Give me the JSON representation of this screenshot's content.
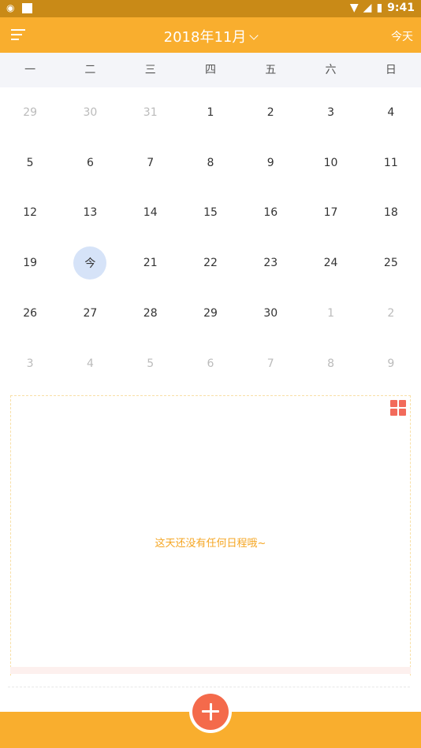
{
  "status": {
    "time": "9:41"
  },
  "header": {
    "title": "2018年11月",
    "today_label": "今天"
  },
  "weekdays": [
    "一",
    "二",
    "三",
    "四",
    "五",
    "六",
    "日"
  ],
  "calendar": {
    "rows": [
      [
        "29",
        "30",
        "31",
        "1",
        "2",
        "3",
        "4"
      ],
      [
        "5",
        "6",
        "7",
        "8",
        "9",
        "10",
        "11"
      ],
      [
        "12",
        "13",
        "14",
        "15",
        "16",
        "17",
        "18"
      ],
      [
        "19",
        "今",
        "21",
        "22",
        "23",
        "24",
        "25"
      ],
      [
        "26",
        "27",
        "28",
        "29",
        "30",
        "1",
        "2"
      ],
      [
        "3",
        "4",
        "5",
        "6",
        "7",
        "8",
        "9"
      ]
    ],
    "other_month": [
      [
        true,
        true,
        true,
        false,
        false,
        false,
        false
      ],
      [
        false,
        false,
        false,
        false,
        false,
        false,
        false
      ],
      [
        false,
        false,
        false,
        false,
        false,
        false,
        false
      ],
      [
        false,
        false,
        false,
        false,
        false,
        false,
        false
      ],
      [
        false,
        false,
        false,
        false,
        false,
        true,
        true
      ],
      [
        true,
        true,
        true,
        true,
        true,
        true,
        true
      ]
    ],
    "today": {
      "row": 3,
      "col": 1
    }
  },
  "schedule": {
    "empty_text": "这天还没有任何日程哦~"
  },
  "colors": {
    "accent": "#F9AE2E",
    "statusbar": "#C98A17",
    "today_bg": "#D6E3F8",
    "fab": "#F46A4B",
    "empty_text": "#F5A623"
  }
}
